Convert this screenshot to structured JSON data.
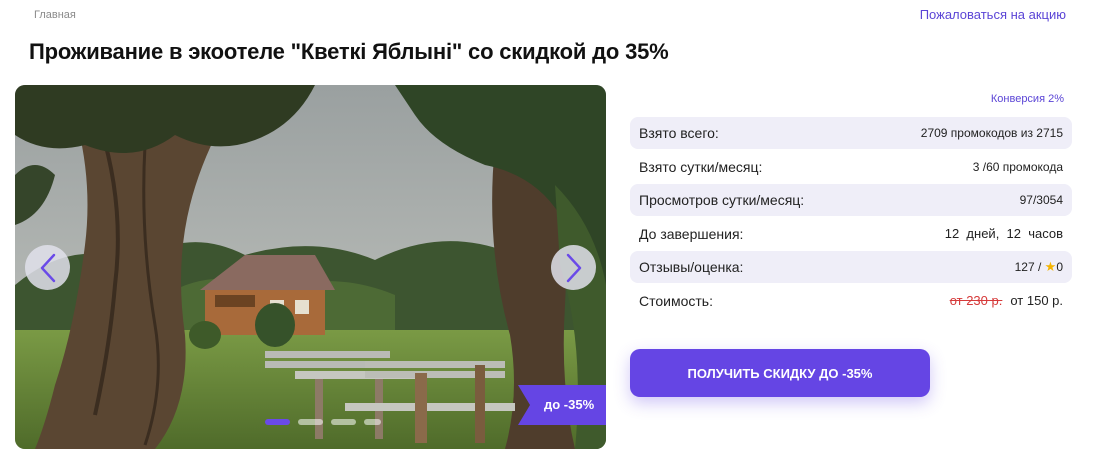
{
  "breadcrumb": "Главная",
  "complain_link": "Пожаловаться на акцию",
  "title": "Проживание в экоотеле \"Кветкі Яблыні\" со скидкой до 35%",
  "gallery": {
    "discount_badge": "до -35%",
    "slide_count": 4,
    "active_slide": 1
  },
  "stats": {
    "conversion": "Конверсия 2%",
    "rows": [
      {
        "label": "Взято всего:",
        "value": "2709 промокодов из 2715"
      },
      {
        "label": "Взято сутки/месяц:",
        "value": "3 /60 промокода"
      },
      {
        "label": "Просмотров сутки/месяц:",
        "value": "97/3054"
      },
      {
        "label": "До завершения:",
        "value": "12  дней,  12  часов"
      },
      {
        "label": "Отзывы/оценка:",
        "value_prefix": "127 / ",
        "value_suffix": "0"
      },
      {
        "label": "Стоимость:",
        "old_price": "от 230 р.",
        "new_price": "от 150 р."
      }
    ]
  },
  "cta_label": "ПОЛУЧИТЬ СКИДКУ ДО -35%",
  "colors": {
    "accent": "#6545e4",
    "row_bg": "#efeef8",
    "old_price": "#d63a3a",
    "star": "#f4b400"
  }
}
